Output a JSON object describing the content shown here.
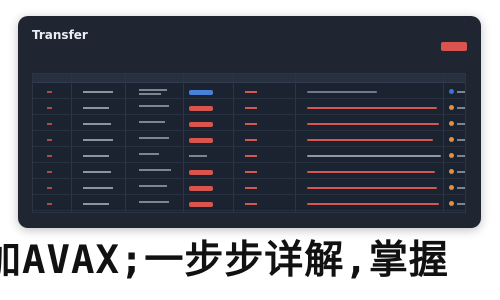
{
  "window": {
    "title": "Transfer"
  },
  "header_button": {
    "color": "#d9534f"
  },
  "table": {
    "rows": [
      {
        "status": "blue",
        "desc_color": "#6f7b8a",
        "icon_color": "#3a73d6"
      },
      {
        "status": "red",
        "desc_color": "#d35752",
        "icon_color": "#e0903a"
      },
      {
        "status": "red",
        "desc_color": "#d35752",
        "icon_color": "#e0903a"
      },
      {
        "status": "red",
        "desc_color": "#d35752",
        "icon_color": "#e0903a"
      },
      {
        "status": "none",
        "desc_color": "#8e98a5",
        "icon_color": "#e0903a"
      },
      {
        "status": "red",
        "desc_color": "#d35752",
        "icon_color": "#e0903a"
      },
      {
        "status": "red",
        "desc_color": "#d35752",
        "icon_color": "#e0903a"
      },
      {
        "status": "red",
        "desc_color": "#d35752",
        "icon_color": "#e0903a"
      }
    ],
    "colors": {
      "red": "#d9534f",
      "blue": "#4a7fd8"
    }
  },
  "banner": {
    "text": "加AVAX;一步步详解,掌握"
  }
}
